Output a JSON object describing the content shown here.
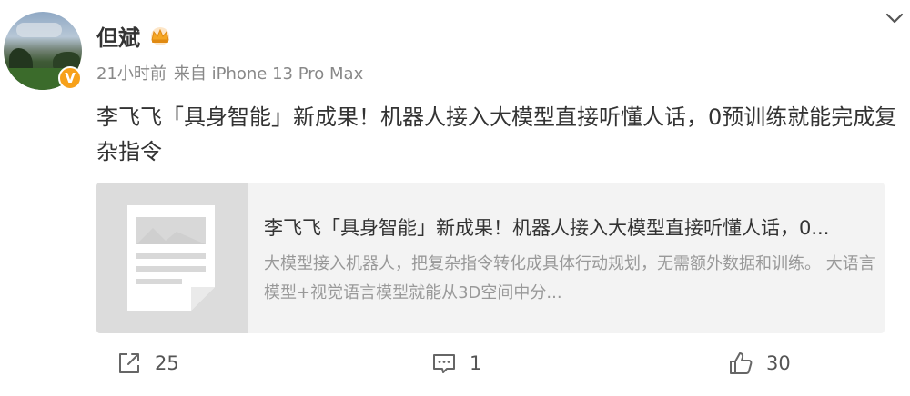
{
  "author": {
    "name": "但斌",
    "verified_badge": "V"
  },
  "meta": {
    "time": "21小时前",
    "source": "来自 iPhone 13 Pro Max"
  },
  "post": {
    "text": "李飞飞「具身智能」新成果！机器人接入大模型直接听懂人话，0预训练就能完成复杂指令"
  },
  "card": {
    "title": "李飞飞「具身智能」新成果！机器人接入大模型直接听懂人话，0...",
    "description": "大模型接入机器人，把复杂指令转化成具体行动规划，无需额外数据和训练。 大语言模型+视觉语言模型就能从3D空间中分..."
  },
  "actions": {
    "share_count": "25",
    "comment_count": "1",
    "like_count": "30"
  },
  "colors": {
    "text": "#333333",
    "meta": "#888888",
    "card_bg": "#f3f3f3",
    "badge": "#f7a11a"
  },
  "icons": [
    "crown-icon",
    "chevron-down-icon",
    "share-icon",
    "comment-icon",
    "like-icon",
    "article-placeholder-icon"
  ]
}
